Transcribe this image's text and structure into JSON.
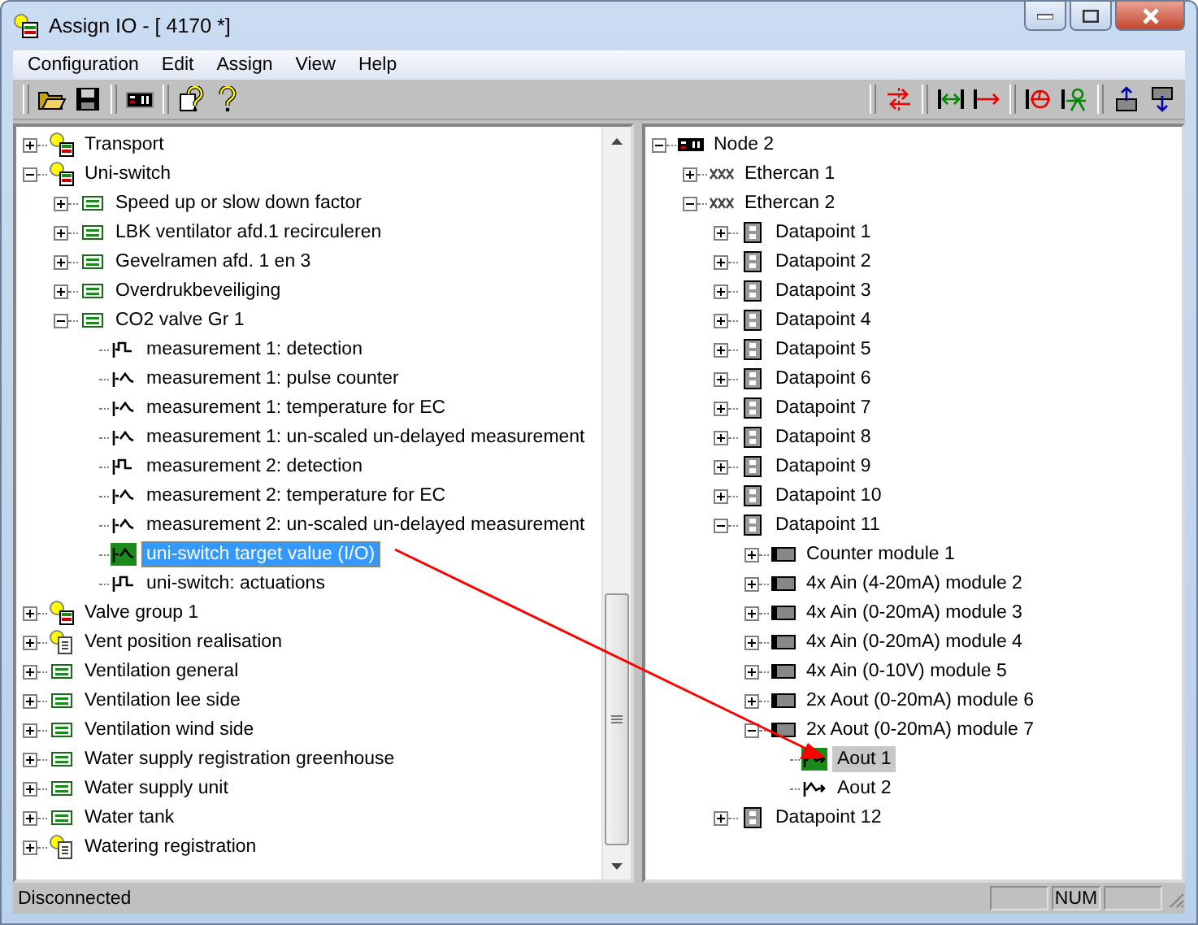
{
  "window": {
    "title": "Assign IO - [ 4170  *]"
  },
  "menu": [
    "Configuration",
    "Edit",
    "Assign",
    "View",
    "Help"
  ],
  "left_tree": {
    "focused": true,
    "items": [
      {
        "label": "Transport",
        "kind": "group",
        "expanded": false,
        "selected": false
      },
      {
        "label": "Uni-switch",
        "kind": "group",
        "expanded": true,
        "selected": false,
        "children": [
          {
            "label": "Speed up or slow down factor",
            "kind": "module",
            "expanded": false,
            "selected": false
          },
          {
            "label": "LBK ventilator afd.1 recirculeren",
            "kind": "module",
            "expanded": false,
            "selected": false
          },
          {
            "label": "Gevelramen afd. 1 en 3",
            "kind": "module",
            "expanded": false,
            "selected": false
          },
          {
            "label": "Overdrukbeveiliging",
            "kind": "module",
            "expanded": false,
            "selected": false
          },
          {
            "label": "CO2 valve Gr 1",
            "kind": "module",
            "expanded": true,
            "selected": false,
            "children": [
              {
                "label": "measurement 1: detection",
                "kind": "digital-in",
                "selected": false
              },
              {
                "label": "measurement 1: pulse counter",
                "kind": "analog-in",
                "selected": false
              },
              {
                "label": "measurement 1: temperature for EC",
                "kind": "analog-in",
                "selected": false
              },
              {
                "label": "measurement 1: un-scaled un-delayed measurement",
                "kind": "analog-in",
                "selected": false
              },
              {
                "label": "measurement 2: detection",
                "kind": "digital-in",
                "selected": false
              },
              {
                "label": "measurement 2: temperature for EC",
                "kind": "analog-in",
                "selected": false
              },
              {
                "label": "measurement 2: un-scaled un-delayed measurement",
                "kind": "analog-in",
                "selected": false
              },
              {
                "label": "uni-switch target value (I/O)",
                "kind": "analog-in",
                "selected": true
              },
              {
                "label": "uni-switch: actuations",
                "kind": "digital-out",
                "selected": false
              }
            ]
          }
        ]
      },
      {
        "label": "Valve group 1",
        "kind": "group",
        "expanded": false,
        "selected": false
      },
      {
        "label": "Vent position realisation",
        "kind": "doc",
        "expanded": false,
        "selected": false
      },
      {
        "label": "Ventilation general",
        "kind": "module",
        "expanded": false,
        "selected": false
      },
      {
        "label": "Ventilation lee side",
        "kind": "module",
        "expanded": false,
        "selected": false
      },
      {
        "label": "Ventilation wind side",
        "kind": "module",
        "expanded": false,
        "selected": false
      },
      {
        "label": "Water supply registration greenhouse",
        "kind": "module",
        "expanded": false,
        "selected": false
      },
      {
        "label": "Water supply unit",
        "kind": "module",
        "expanded": false,
        "selected": false
      },
      {
        "label": "Water tank",
        "kind": "module",
        "expanded": false,
        "selected": false
      },
      {
        "label": "Watering registration",
        "kind": "doc",
        "expanded": false,
        "selected": false
      }
    ]
  },
  "right_tree": {
    "focused": false,
    "items": [
      {
        "label": "Node 2",
        "kind": "node",
        "expanded": true,
        "selected": false,
        "children": [
          {
            "label": "Ethercan 1",
            "kind": "bus",
            "expanded": false,
            "selected": false
          },
          {
            "label": "Ethercan 2",
            "kind": "bus",
            "expanded": true,
            "selected": false,
            "children": [
              {
                "label": "Datapoint 1",
                "kind": "datapoint",
                "expanded": false,
                "selected": false
              },
              {
                "label": "Datapoint 2",
                "kind": "datapoint",
                "expanded": false,
                "selected": false
              },
              {
                "label": "Datapoint 3",
                "kind": "datapoint",
                "expanded": false,
                "selected": false
              },
              {
                "label": "Datapoint 4",
                "kind": "datapoint",
                "expanded": false,
                "selected": false
              },
              {
                "label": "Datapoint 5",
                "kind": "datapoint",
                "expanded": false,
                "selected": false
              },
              {
                "label": "Datapoint 6",
                "kind": "datapoint",
                "expanded": false,
                "selected": false
              },
              {
                "label": "Datapoint 7",
                "kind": "datapoint",
                "expanded": false,
                "selected": false
              },
              {
                "label": "Datapoint 8",
                "kind": "datapoint",
                "expanded": false,
                "selected": false
              },
              {
                "label": "Datapoint 9",
                "kind": "datapoint",
                "expanded": false,
                "selected": false
              },
              {
                "label": "Datapoint 10",
                "kind": "datapoint",
                "expanded": false,
                "selected": false
              },
              {
                "label": "Datapoint 11",
                "kind": "datapoint",
                "expanded": true,
                "selected": false,
                "children": [
                  {
                    "label": "Counter module 1",
                    "kind": "io-module",
                    "expanded": false,
                    "selected": false
                  },
                  {
                    "label": "4x Ain (4-20mA) module 2",
                    "kind": "io-module",
                    "expanded": false,
                    "selected": false
                  },
                  {
                    "label": "4x Ain (0-20mA) module 3",
                    "kind": "io-module",
                    "expanded": false,
                    "selected": false
                  },
                  {
                    "label": "4x Ain (0-20mA) module 4",
                    "kind": "io-module",
                    "expanded": false,
                    "selected": false
                  },
                  {
                    "label": "4x Ain (0-10V) module 5",
                    "kind": "io-module",
                    "expanded": false,
                    "selected": false
                  },
                  {
                    "label": "2x Aout (0-20mA) module 6",
                    "kind": "io-module",
                    "expanded": false,
                    "selected": false
                  },
                  {
                    "label": "2x Aout (0-20mA) module 7",
                    "kind": "io-module",
                    "expanded": true,
                    "selected": false,
                    "children": [
                      {
                        "label": "Aout 1",
                        "kind": "analog-out",
                        "selected": true
                      },
                      {
                        "label": "Aout 2",
                        "kind": "analog-out",
                        "selected": false
                      }
                    ]
                  }
                ]
              },
              {
                "label": "Datapoint 12",
                "kind": "datapoint",
                "expanded": false,
                "selected": false
              }
            ]
          }
        ]
      }
    ]
  },
  "status_bar": {
    "text": "Disconnected",
    "indicators": [
      {
        "kind": "blank"
      },
      {
        "kind": "text",
        "label": "NUM"
      },
      {
        "kind": "blank"
      }
    ]
  }
}
